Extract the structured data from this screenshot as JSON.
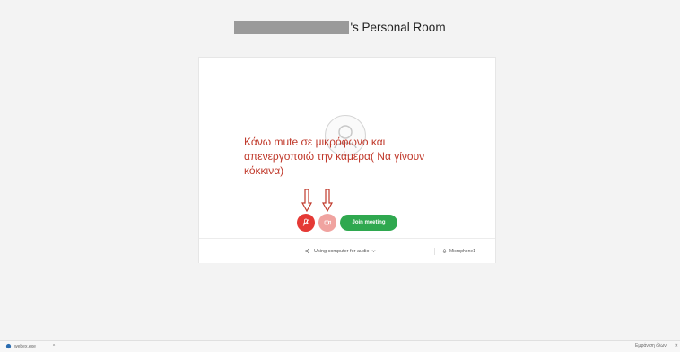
{
  "header": {
    "title_suffix": "'s Personal Room"
  },
  "annotation": {
    "note_text": "Κάνω mute σε μικρόφωνο και απενεργοποιώ την κάμερα( Να γίνουν κόκκινα)",
    "color": "#c0392b"
  },
  "controls": {
    "join_label": "Join meeting",
    "mic_color": "#e53935",
    "camera_color": "#f0a3a0",
    "join_color": "#2fa84f"
  },
  "footer": {
    "audio_label": "Using computer for audio",
    "mic_label": "Microphone1"
  },
  "taskbar": {
    "left_label": "webex.exe",
    "right_label": "Εμφάνιση όλων"
  },
  "icons": {
    "audio": "speaker-icon",
    "dropdown": "chevron-down-icon",
    "mic": "microphone-icon",
    "camera": "camera-icon",
    "avatar": "user-icon"
  }
}
